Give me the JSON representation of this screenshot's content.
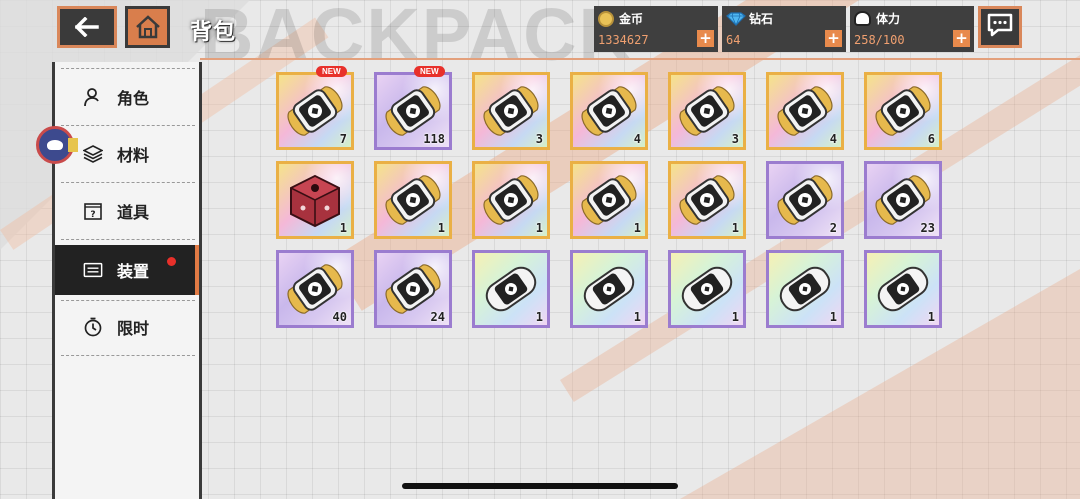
{
  "header": {
    "title": "背包",
    "watermark": "BACKPACK",
    "back_icon": "arrow-left-icon",
    "home_icon": "house-icon",
    "chat_icon": "chat-bubble-icon"
  },
  "resources": {
    "coin": {
      "label": "金币",
      "value": "1334627",
      "icon": "coin-icon"
    },
    "diamond": {
      "label": "钻石",
      "value": "64",
      "icon": "diamond-icon"
    },
    "stamina": {
      "label": "体力",
      "value": "258/100",
      "icon": "stamina-icon"
    },
    "plus_symbol": "+"
  },
  "sidebar": {
    "items": [
      {
        "label": "角色",
        "icon": "person-icon",
        "active": false
      },
      {
        "label": "材料",
        "icon": "layers-icon",
        "active": false
      },
      {
        "label": "道具",
        "icon": "question-box-icon",
        "active": false
      },
      {
        "label": "装置",
        "icon": "device-icon",
        "active": true,
        "notification": true
      },
      {
        "label": "限时",
        "icon": "timer-icon",
        "active": false
      }
    ]
  },
  "inventory": {
    "new_label": "NEW",
    "rows": [
      [
        {
          "count": "7",
          "rarity": "gold",
          "kind": "capsule-ornate",
          "new": true
        },
        {
          "count": "118",
          "rarity": "purple",
          "kind": "capsule-ornate",
          "new": true
        },
        {
          "count": "3",
          "rarity": "gold",
          "kind": "capsule-ornate"
        },
        {
          "count": "4",
          "rarity": "gold",
          "kind": "capsule-ornate"
        },
        {
          "count": "3",
          "rarity": "gold",
          "kind": "capsule-ornate"
        },
        {
          "count": "4",
          "rarity": "gold",
          "kind": "capsule-ornate"
        },
        {
          "count": "6",
          "rarity": "gold",
          "kind": "capsule-ornate"
        }
      ],
      [
        {
          "count": "1",
          "rarity": "gold",
          "kind": "red-cube"
        },
        {
          "count": "1",
          "rarity": "gold",
          "kind": "capsule-ornate"
        },
        {
          "count": "1",
          "rarity": "gold",
          "kind": "capsule-ornate"
        },
        {
          "count": "1",
          "rarity": "gold",
          "kind": "capsule-ornate"
        },
        {
          "count": "1",
          "rarity": "gold",
          "kind": "capsule-ornate"
        },
        {
          "count": "2",
          "rarity": "purple",
          "kind": "capsule-ornate"
        },
        {
          "count": "23",
          "rarity": "purple",
          "kind": "capsule-ornate"
        }
      ],
      [
        {
          "count": "40",
          "rarity": "purple",
          "kind": "capsule-ornate"
        },
        {
          "count": "24",
          "rarity": "purple",
          "kind": "capsule-ornate"
        },
        {
          "count": "1",
          "rarity": "purple",
          "kind": "capsule-plain"
        },
        {
          "count": "1",
          "rarity": "purple",
          "kind": "capsule-plain"
        },
        {
          "count": "1",
          "rarity": "purple",
          "kind": "capsule-plain"
        },
        {
          "count": "1",
          "rarity": "purple",
          "kind": "capsule-plain"
        },
        {
          "count": "1",
          "rarity": "purple",
          "kind": "capsule-plain"
        }
      ]
    ]
  },
  "colors": {
    "accent": "#e27b45",
    "gold_frame": "#eab045",
    "purple_frame": "#9b7ccf",
    "dark": "#3a3a3a",
    "notification": "#e8302a"
  }
}
